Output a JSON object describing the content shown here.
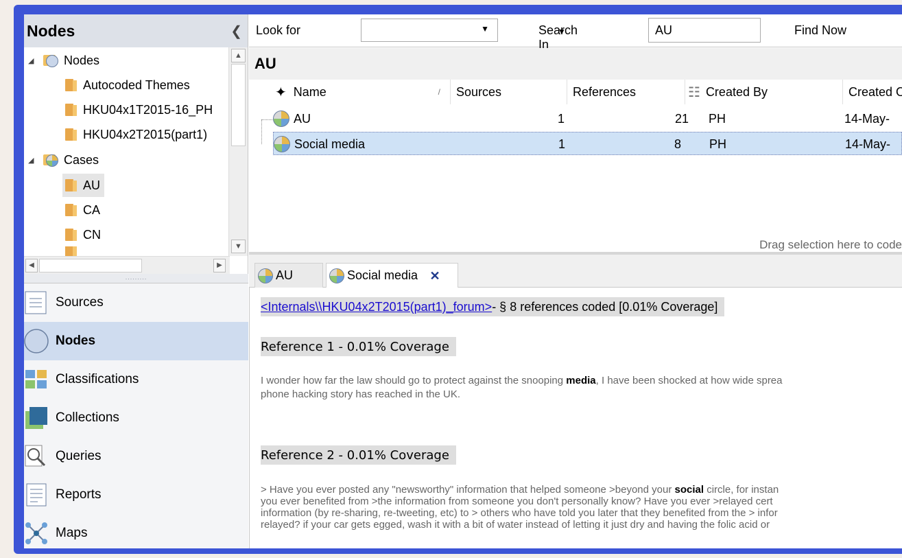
{
  "left_panel": {
    "title": "Nodes",
    "tree": [
      {
        "label": "Nodes",
        "level": 0,
        "expanded": true,
        "icon": "node-folder-icon"
      },
      {
        "label": "Autocoded Themes",
        "level": 1,
        "icon": "folder-icon"
      },
      {
        "label": "HKU04x1T2015-16_PH",
        "level": 1,
        "icon": "folder-icon"
      },
      {
        "label": "HKU04x2T2015(part1)",
        "level": 1,
        "icon": "folder-icon"
      },
      {
        "label": "Cases",
        "level": 0,
        "expanded": true,
        "icon": "cases-folder-icon"
      },
      {
        "label": "AU",
        "level": 1,
        "icon": "folder-icon",
        "selected": true
      },
      {
        "label": "CA",
        "level": 1,
        "icon": "folder-icon"
      },
      {
        "label": "CN",
        "level": 1,
        "icon": "folder-icon"
      }
    ],
    "nav": [
      {
        "label": "Sources",
        "icon": "sources-icon"
      },
      {
        "label": "Nodes",
        "icon": "nodes-icon",
        "active": true
      },
      {
        "label": "Classifications",
        "icon": "classifications-icon"
      },
      {
        "label": "Collections",
        "icon": "collections-icon"
      },
      {
        "label": "Queries",
        "icon": "queries-icon"
      },
      {
        "label": "Reports",
        "icon": "reports-icon"
      },
      {
        "label": "Maps",
        "icon": "maps-icon"
      }
    ]
  },
  "toolbar": {
    "look_for_label": "Look for",
    "look_for_value": "",
    "search_in_label": "Search In",
    "search_in_value": "AU",
    "find_now_label": "Find Now"
  },
  "list": {
    "heading": "AU",
    "columns": [
      "Name",
      "Sources",
      "References",
      "Created By",
      "Created O"
    ],
    "rows": [
      {
        "name": "AU",
        "sources": "1",
        "references": "21",
        "created_by": "PH",
        "created_on": "14-May-"
      },
      {
        "name": "Social media",
        "sources": "1",
        "references": "8",
        "created_by": "PH",
        "created_on": "14-May-",
        "selected": true
      }
    ],
    "drag_hint": "Drag selection here to code"
  },
  "tabs": [
    {
      "label": "AU"
    },
    {
      "label": "Social media",
      "active": true
    }
  ],
  "detail": {
    "source_link": "<Internals\\\\HKU04x2T2015(part1)_forum>",
    "summary": " - § 8 references coded  [0.01% Coverage]",
    "ref1_title": "Reference 1 - 0.01% Coverage",
    "ref1_a": "I wonder how far the law should go to protect against the snooping ",
    "ref1_b": "media",
    "ref1_c": ", I have been shocked at how wide sprea",
    "ref1_line2": "phone hacking story has reached in the UK.",
    "ref2_title": "Reference 2 - 0.01% Coverage",
    "ref2_a": "> Have you ever posted any \"newsworthy\" information that helped someone >beyond your ",
    "ref2_b": "social",
    "ref2_c": " circle, for instan",
    "ref2_line2": "you ever benefited from  >the information from someone you don't personally know? Have you ever >relayed cert",
    "ref2_line3": "information (by re-sharing, re-tweeting, etc) to > others who have told you later that they benefited from the > infor",
    "ref2_line4": "relayed? if your car gets egged, wash it with a bit of water instead of letting it just dry and having the folic acid or"
  }
}
